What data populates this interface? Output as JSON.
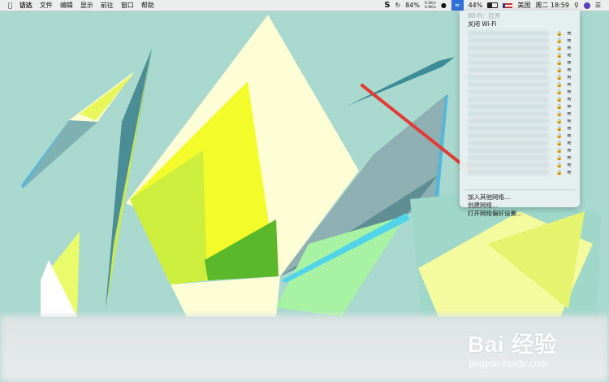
{
  "menubar": {
    "apple_icon": "apple-icon",
    "app_name": "访达",
    "menus": [
      "文件",
      "编辑",
      "显示",
      "前往",
      "窗口",
      "帮助"
    ],
    "skype_letter": "S",
    "battery_small_pct": "84%",
    "net_up": "0.5K/s",
    "net_down": "0.6K/s",
    "battery_pct": "44%",
    "input_method": "美国",
    "datetime": "周二 18:59"
  },
  "wifi_menu": {
    "status": "Wi-Fi：打开",
    "toggle_label": "关闭 Wi-Fi",
    "network_count": 20,
    "join_other": "加入其他网络...",
    "create_network": "创建网络...",
    "open_prefs": "打开网络偏好设置..."
  },
  "watermark": {
    "logo": "Bai 经验",
    "url": "jingyan.baidu.com"
  },
  "colors": {
    "accent_blue": "#2f6fd8",
    "arrow_red": "#e23b33",
    "desktop_bg": "#a9d8cf"
  }
}
